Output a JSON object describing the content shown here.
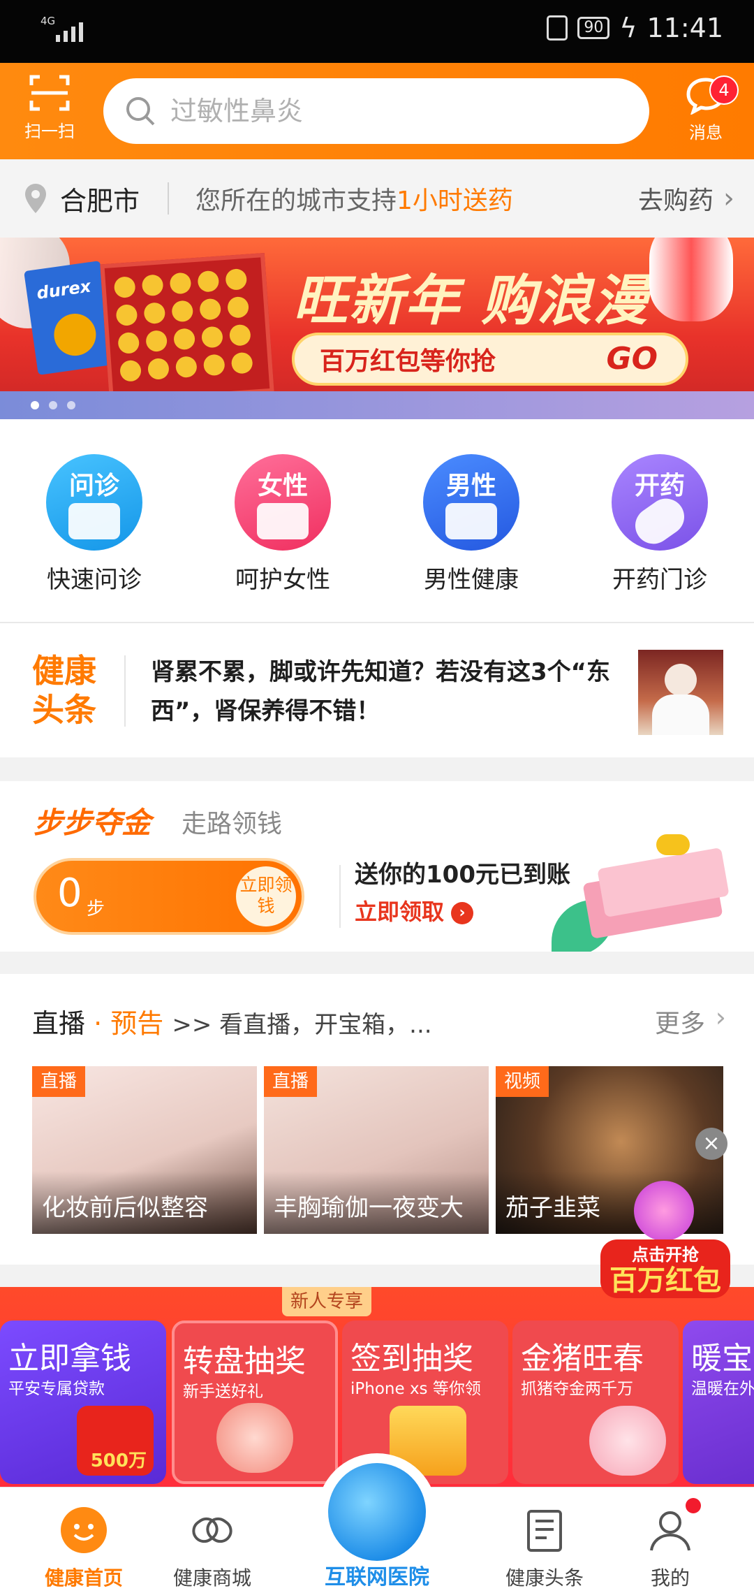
{
  "status": {
    "network": "4G",
    "battery": "90",
    "time": "11:41"
  },
  "header": {
    "scan_label": "扫一扫",
    "search_placeholder": "过敏性鼻炎",
    "message_label": "消息",
    "message_badge": "4"
  },
  "location": {
    "city": "合肥市",
    "info_prefix": "您所在的城市支持",
    "info_highlight": "1小时送药",
    "action": "去购药"
  },
  "banner": {
    "headline": "旺新年 购浪漫",
    "pill_text": "百万红包等你抢",
    "go": "GO",
    "pack_text": "durex",
    "slide_count": 3,
    "active_slide": 0
  },
  "categories": [
    {
      "icon_text": "问诊",
      "label": "快速问诊",
      "color": "#2aa6f0",
      "icon": "medical-kit-icon"
    },
    {
      "icon_text": "女性",
      "label": "呵护女性",
      "color": "#f43c6e",
      "icon": "calendar-heart-icon"
    },
    {
      "icon_text": "男性",
      "label": "男性健康",
      "color": "#2f6bea",
      "icon": "muscle-icon"
    },
    {
      "icon_text": "开药",
      "label": "开药门诊",
      "color": "#8a63ea",
      "icon": "pill-icon"
    }
  ],
  "headline": {
    "tag": "健康头条",
    "title": "肾累不累，脚或许先知道？若没有这3个“东西”，肾保养得不错！"
  },
  "steps": {
    "title": "步步夺金",
    "subtitle": "走路领钱",
    "count": "0",
    "unit": "步",
    "button": "立即领钱",
    "promo_line1": "送你的100元已到账",
    "promo_line2": "立即领取"
  },
  "live": {
    "title": "直播",
    "preview": "· 预告",
    "rest": ">> 看直播，开宝箱，...",
    "more": "更多",
    "cards": [
      {
        "tag": "直播",
        "caption": "化妆前后似整容"
      },
      {
        "tag": "直播",
        "caption": "丰胸瑜伽一夜变大"
      },
      {
        "tag": "视频",
        "caption": "茄子韭菜"
      }
    ]
  },
  "redpacket": {
    "line1": "点击开抢",
    "line2": "百万红包"
  },
  "promo": {
    "new_tag": "新人专享",
    "cards": [
      {
        "title": "立即拿钱",
        "subtitle": "平安专属贷款",
        "extra": "500万",
        "color": "#6f3bea"
      },
      {
        "title": "转盘抽奖",
        "subtitle": "新手送好礼",
        "color": "#f2474b"
      },
      {
        "title": "签到抽奖",
        "subtitle": "iPhone xs 等你领",
        "color": "#f2474b"
      },
      {
        "title": "金猪旺春",
        "subtitle": "抓猪夺金两千万",
        "color": "#f2474b"
      },
      {
        "title": "暖宝",
        "subtitle": "温暖在外",
        "color": "#7c3bdc"
      }
    ]
  },
  "nav": {
    "items": [
      {
        "label": "健康首页",
        "active": true
      },
      {
        "label": "健康商城",
        "active": false
      },
      {
        "label": "互联网医院",
        "active": false
      },
      {
        "label": "健康头条",
        "active": false
      },
      {
        "label": "我的",
        "active": false
      }
    ]
  }
}
